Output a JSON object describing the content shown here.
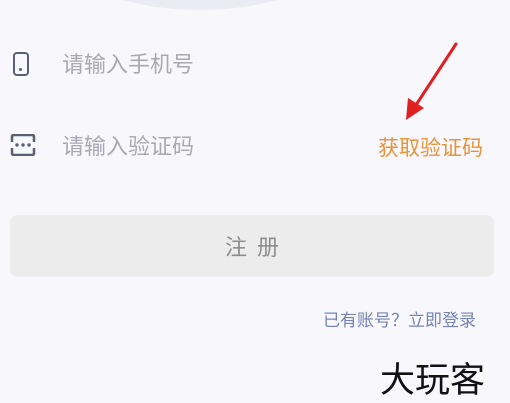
{
  "form": {
    "phone_placeholder": "请输入手机号",
    "phone_value": "",
    "code_placeholder": "请输入验证码",
    "code_value": "",
    "get_code_label": "获取验证码",
    "register_label": "注册",
    "login_link_label": "已有账号？立即登录"
  },
  "watermark": {
    "text": "大玩客"
  },
  "icons": {
    "phone": "smartphone-icon",
    "code": "verification-code-icon",
    "arrow": "annotation-arrow"
  },
  "colors": {
    "background": "#f8f8fc",
    "accent_orange": "#e8923a",
    "link_blue": "#7583b5",
    "button_bg": "#ececec",
    "button_text": "#8d8d8d",
    "arrow_red": "#e02020",
    "placeholder": "#a8a8b0",
    "icon": "#5a6070"
  }
}
